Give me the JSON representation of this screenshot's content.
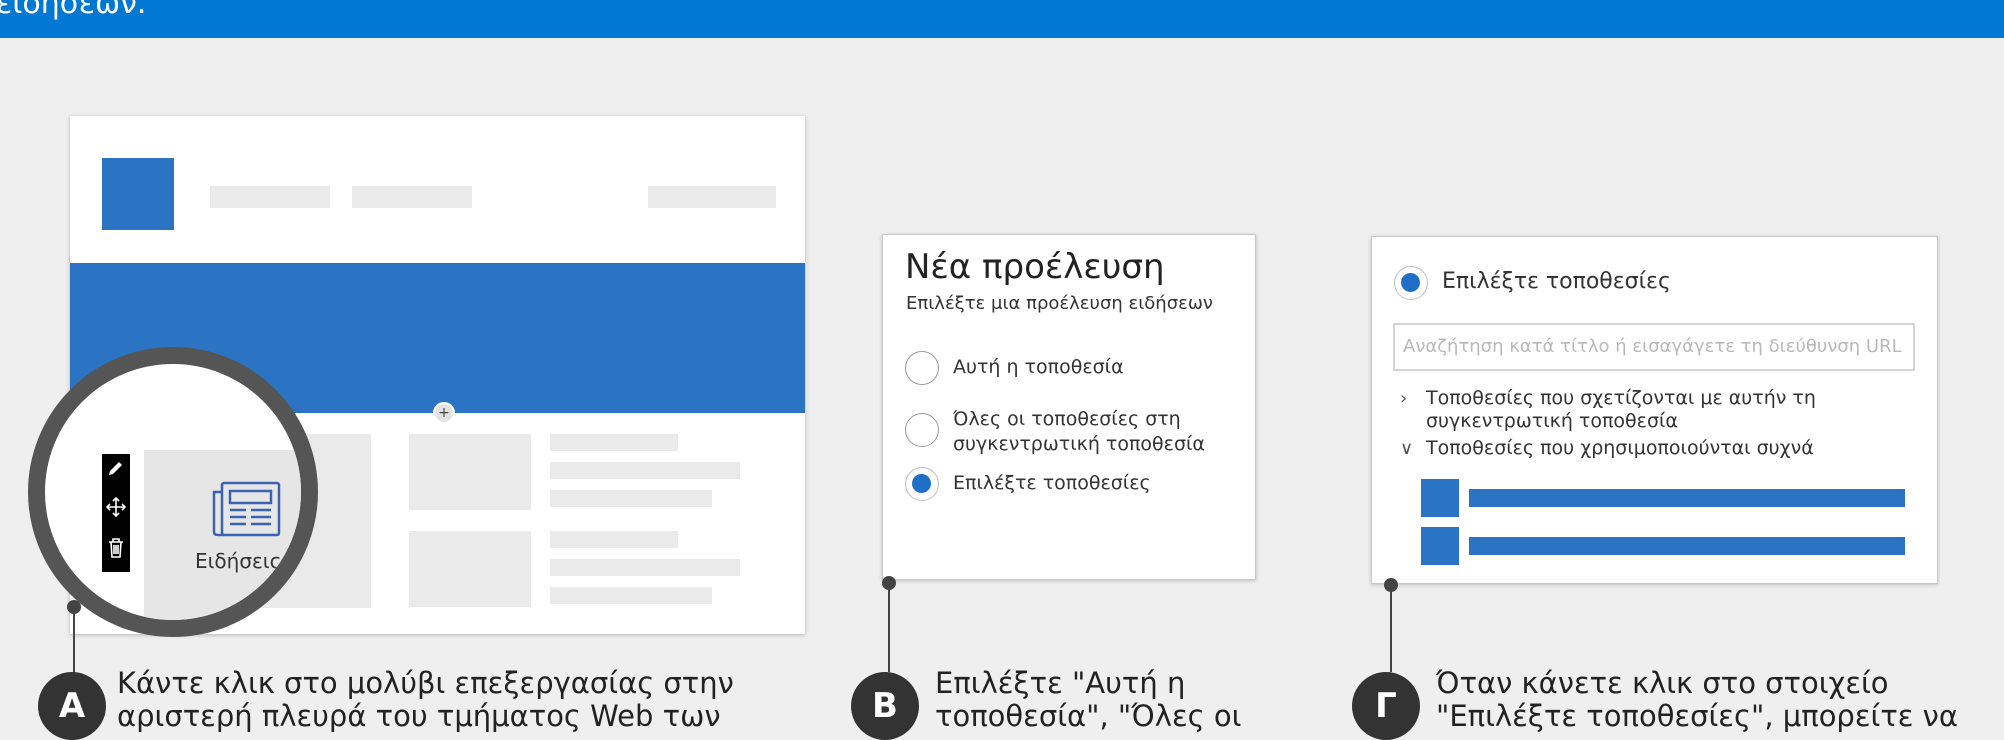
{
  "header": {
    "text": "ειδήσεων."
  },
  "panel_a": {
    "news_label": "Ειδήσεις",
    "toolbar_icons": [
      "pencil-icon",
      "move-icon",
      "trash-icon"
    ],
    "add_symbol": "+",
    "badge": "A",
    "caption_lines": [
      "Κάντε κλικ στο μολύβι επεξεργασίας στην",
      "αριστερή πλευρά του τμήματος Web των"
    ]
  },
  "panel_b": {
    "title": "Νέα προέλευση",
    "subtitle": "Επιλέξτε μια προέλευση ειδήσεων",
    "options": [
      {
        "label": "Αυτή η τοποθεσία",
        "selected": false
      },
      {
        "label": "Όλες οι τοποθεσίες στη συγκεντρωτική τοποθεσία",
        "selected": false
      },
      {
        "label": "Επιλέξτε τοποθεσίες",
        "selected": true
      }
    ],
    "badge": "B",
    "caption_lines": [
      "Επιλέξτε \"Αυτή η",
      "τοποθεσία\", \"Όλες οι"
    ]
  },
  "panel_c": {
    "radio_label": "Επιλέξτε τοποθεσίες",
    "search_placeholder": "Αναζήτηση κατά τίτλο ή εισαγάγετε τη διεύθυνση URL",
    "tree": [
      {
        "label": "Τοποθεσίες που σχετίζονται με αυτήν τη συγκεντρωτική τοποθεσία",
        "expanded": false
      },
      {
        "label": "Τοποθεσίες που χρησιμοποιούνται συχνά",
        "expanded": true
      }
    ],
    "badge": "Γ",
    "caption_lines": [
      "Όταν κάνετε κλικ στο στοιχείο",
      "\"Επιλέξτε τοποθεσίες\", μπορείτε να"
    ]
  },
  "colors": {
    "header": "#0078d4",
    "accent": "#2b74c4",
    "badge": "#333333"
  }
}
